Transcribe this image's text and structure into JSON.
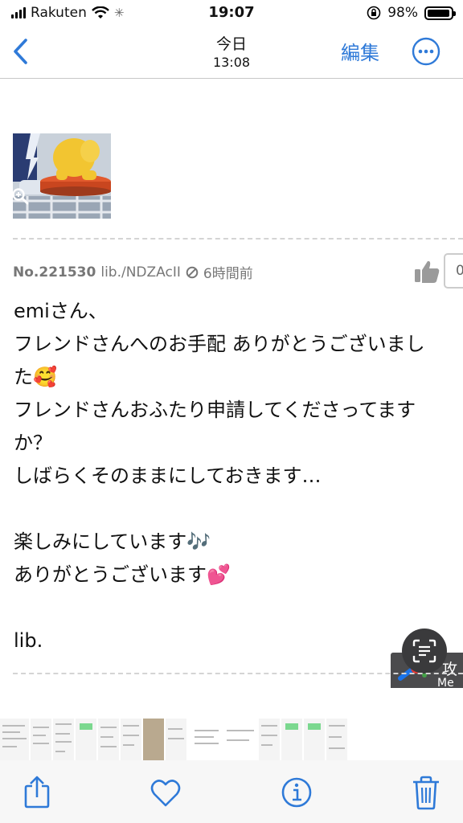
{
  "status_bar": {
    "carrier": "Rakuten",
    "time": "19:07",
    "battery": "98%",
    "battery_level": 0.98
  },
  "nav": {
    "title": "今日",
    "subtitle": "13:08",
    "edit_label": "編集",
    "back_icon": "chevron-left-icon",
    "more_icon": "ellipsis-circle-icon"
  },
  "post": {
    "number": "No.221530",
    "author": "lib./NDZAcII",
    "time_ago": "6時間前",
    "like_count": "0",
    "lines": [
      "emiさん、",
      "フレンドさんへのお手配 ありがとうございまし",
      "た🥰",
      "フレンドさんおふたり申請してくださってます",
      "か？",
      "しばらくそのままにしておきます…",
      "",
      "楽しみにしています🎶",
      "ありがとうございます💕",
      "",
      "lib."
    ]
  },
  "overlay": {
    "badge_char": "攻",
    "badge_sub": "Me"
  },
  "toolbar": {
    "share_icon": "share-icon",
    "favorite_icon": "heart-icon",
    "info_icon": "info-icon",
    "delete_icon": "trash-icon"
  },
  "colors": {
    "accent": "#2f7ad8"
  }
}
